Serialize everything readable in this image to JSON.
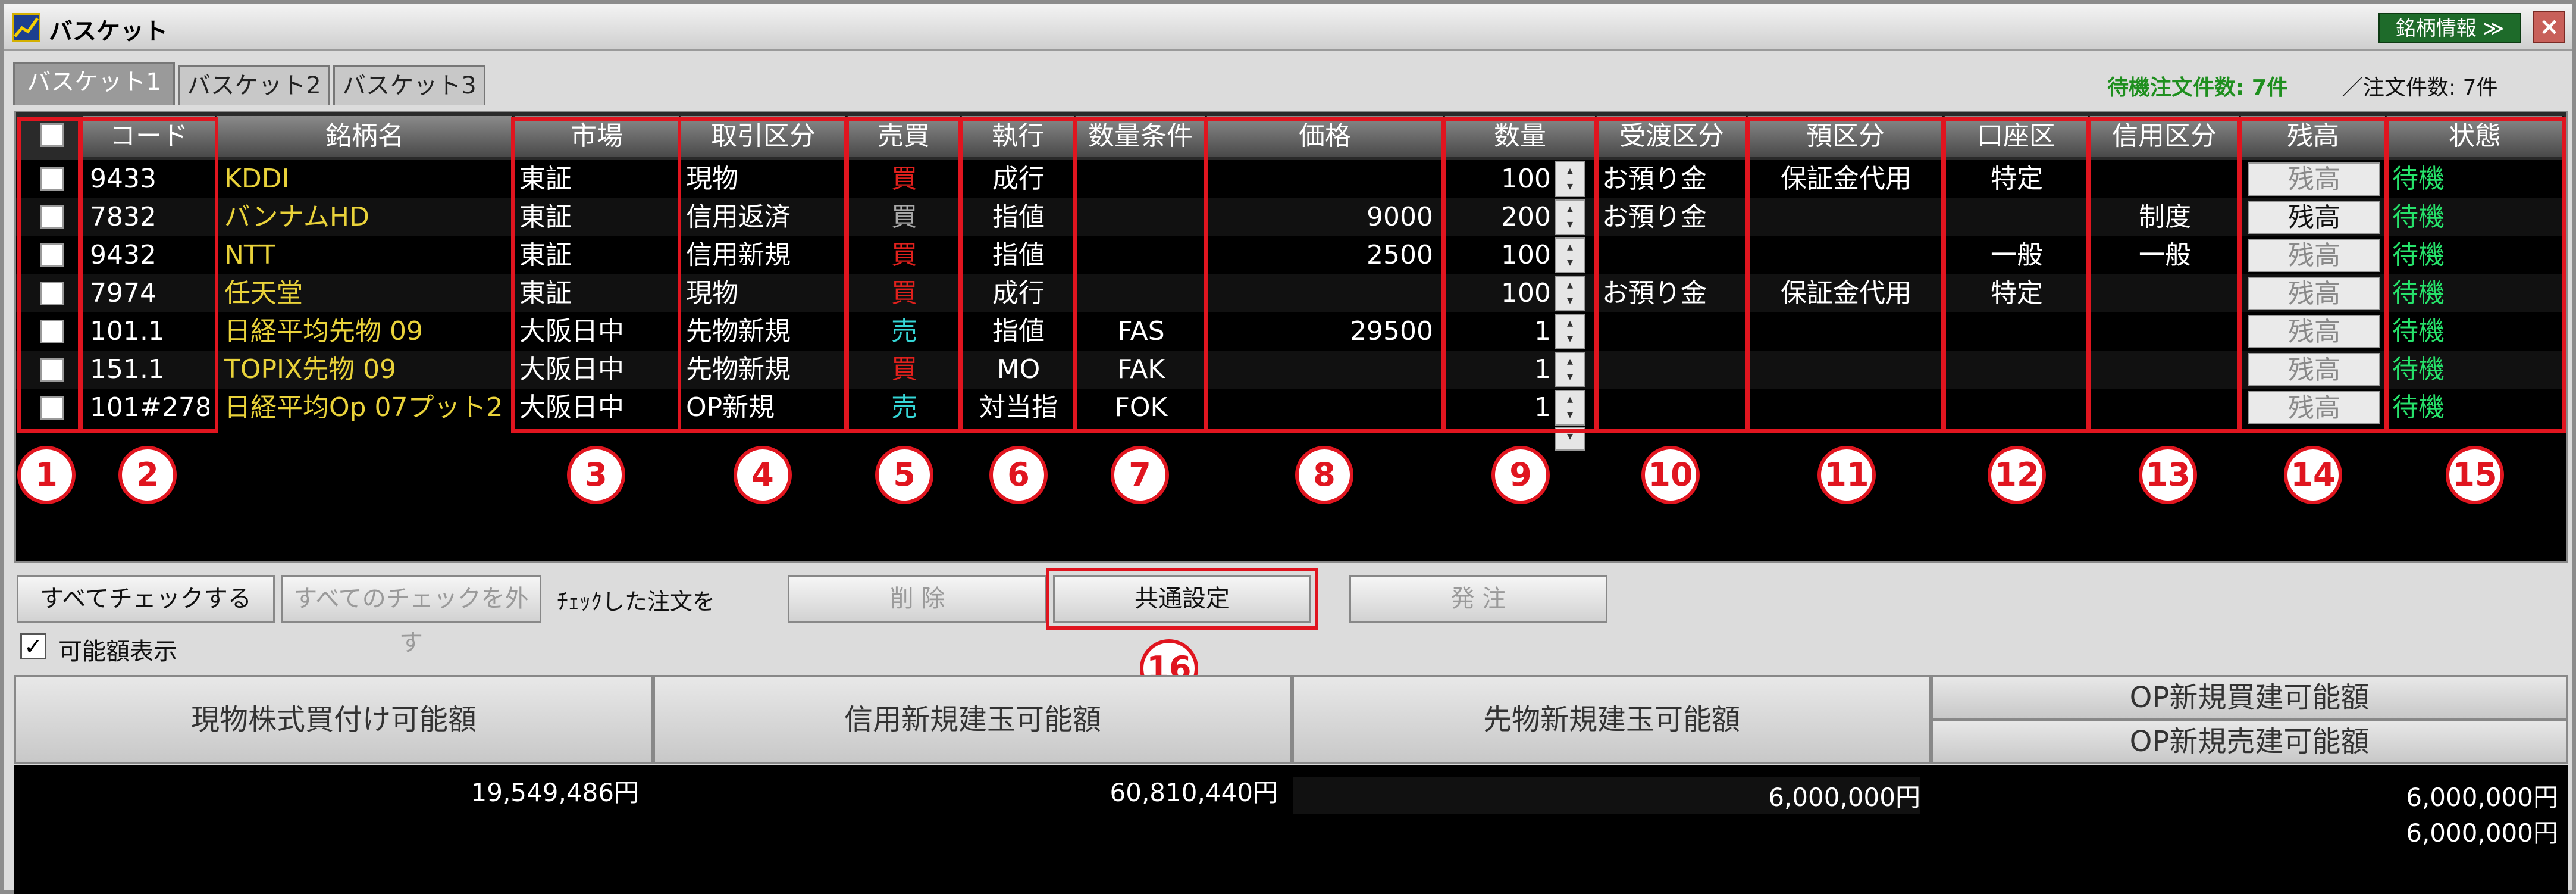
{
  "window": {
    "title": "バスケット",
    "info_button": "銘柄情報 ≫",
    "close_label": "×"
  },
  "tabs": [
    "バスケット1",
    "バスケット2",
    "バスケット3"
  ],
  "counts": {
    "waiting": "待機注文件数: 7件",
    "orders": "／注文件数: 7件"
  },
  "columns": [
    "コード",
    "銘柄名",
    "市場",
    "取引区分",
    "売買",
    "執行",
    "数量条件",
    "価格",
    "数量",
    "受渡区分",
    "預区分",
    "口座区",
    "信用区分",
    "残高",
    "状態"
  ],
  "rows": [
    {
      "code": "9433",
      "name": "KDDI",
      "market": "東証",
      "trade": "現物",
      "side": "買",
      "side_color": "red",
      "exec": "成行",
      "qty_cond": "",
      "price": "",
      "qty": "100",
      "delivery": "お預り金",
      "deposit": "保証金代用",
      "account": "特定",
      "credit": "",
      "balance": "残高",
      "balance_dim": true,
      "status": "待機"
    },
    {
      "code": "7832",
      "name": "バンナムHD",
      "market": "東証",
      "trade": "信用返済",
      "side": "買",
      "side_color": "gray",
      "exec": "指値",
      "qty_cond": "",
      "price": "9000",
      "qty": "200",
      "delivery": "お預り金",
      "deposit": "",
      "account": "",
      "credit": "制度",
      "credit_dim": true,
      "balance": "残高",
      "balance_dim": false,
      "status": "待機"
    },
    {
      "code": "9432",
      "name": "NTT",
      "market": "東証",
      "trade": "信用新規",
      "side": "買",
      "side_color": "red",
      "exec": "指値",
      "qty_cond": "",
      "price": "2500",
      "qty": "100",
      "delivery": "",
      "deposit": "",
      "account": "一般",
      "credit": "一般",
      "balance": "残高",
      "balance_dim": true,
      "status": "待機"
    },
    {
      "code": "7974",
      "name": "任天堂",
      "market": "東証",
      "trade": "現物",
      "side": "買",
      "side_color": "red",
      "exec": "成行",
      "qty_cond": "",
      "price": "",
      "qty": "100",
      "delivery": "お預り金",
      "deposit": "保証金代用",
      "account": "特定",
      "credit": "",
      "balance": "残高",
      "balance_dim": true,
      "status": "待機"
    },
    {
      "code": "101.1",
      "name": "日経平均先物 09",
      "market": "大阪日中",
      "trade": "先物新規",
      "side": "売",
      "side_color": "cyan",
      "exec": "指値",
      "qty_cond": "FAS",
      "price": "29500",
      "qty": "1",
      "delivery": "",
      "deposit": "",
      "account": "",
      "credit": "",
      "balance": "残高",
      "balance_dim": true,
      "status": "待機"
    },
    {
      "code": "151.1",
      "name": "TOPIX先物 09",
      "market": "大阪日中",
      "trade": "先物新規",
      "side": "買",
      "side_color": "red",
      "exec": "MO",
      "qty_cond": "FAK",
      "price": "",
      "qty": "1",
      "delivery": "",
      "deposit": "",
      "account": "",
      "credit": "",
      "balance": "残高",
      "balance_dim": true,
      "status": "待機"
    },
    {
      "code": "101#278.",
      "name": "日経平均Op 07プット2",
      "market": "大阪日中",
      "trade": "OP新規",
      "side": "売",
      "side_color": "cyan",
      "exec": "対当指",
      "qty_cond": "FOK",
      "price": "",
      "qty": "1",
      "delivery": "",
      "deposit": "",
      "account": "",
      "credit": "",
      "balance": "残高",
      "balance_dim": true,
      "status": "待機"
    }
  ],
  "markers": [
    "1",
    "2",
    "3",
    "4",
    "5",
    "6",
    "7",
    "8",
    "9",
    "10",
    "11",
    "12",
    "13",
    "14",
    "15",
    "16"
  ],
  "actions": {
    "check_all": "すべてチェックする",
    "uncheck_all": "すべてのチェックを外す",
    "checked_label": "ﾁｪｯｸした注文を",
    "delete": "削 除",
    "common": "共通設定",
    "order": "発 注"
  },
  "avail": {
    "label": "可能額表示",
    "checked": true
  },
  "summary": {
    "cash_label": "現物株式買付け可能額",
    "cash_value": "19,549,486円",
    "margin_label": "信用新規建玉可能額",
    "margin_value": "60,810,440円",
    "futures_label": "先物新規建玉可能額",
    "futures_value": "6,000,000円",
    "op_buy_label": "OP新規買建可能額",
    "op_buy_value": "6,000,000円",
    "op_sell_label": "OP新規売建可能額",
    "op_sell_value": "6,000,000円"
  },
  "colors": {
    "header_green": "#1e6b2a",
    "annotation_red": "#e0151f",
    "status_green": "#26e26a",
    "name_yellow": "#e9d23a"
  }
}
